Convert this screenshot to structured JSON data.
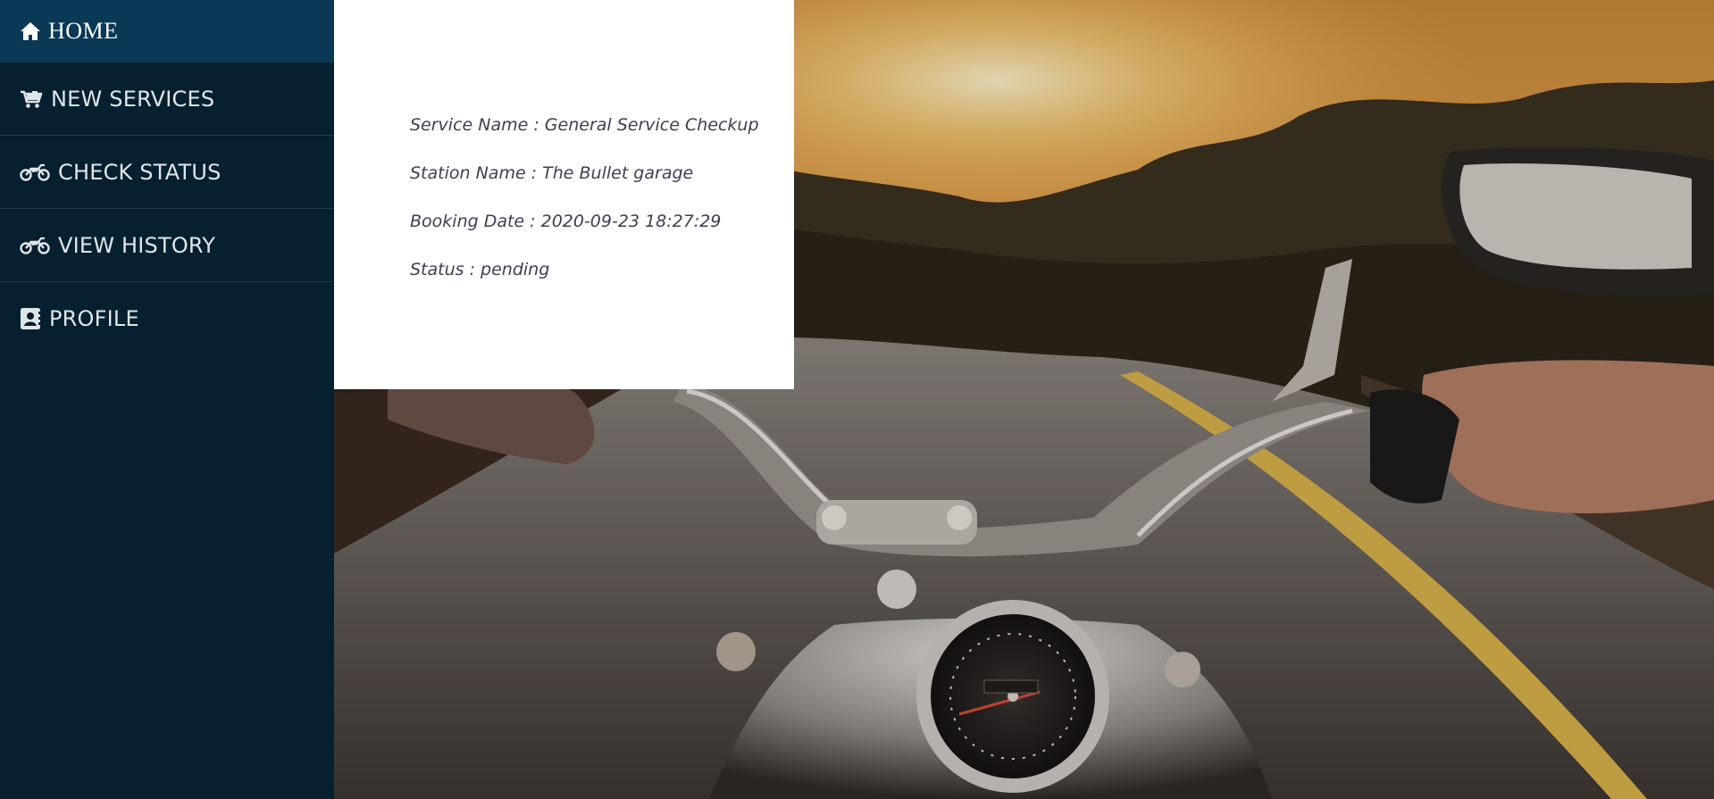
{
  "sidebar": {
    "home": {
      "label": "HOME",
      "icon": "home-icon"
    },
    "items": [
      {
        "label": "NEW SERVICES",
        "icon": "cart-icon"
      },
      {
        "label": "CHECK STATUS",
        "icon": "motorcycle-icon"
      },
      {
        "label": "VIEW HISTORY",
        "icon": "motorcycle-icon"
      },
      {
        "label": "PROFILE",
        "icon": "address-book-icon"
      }
    ]
  },
  "booking": {
    "service_name": "Service Name : General Service Checkup",
    "station_name": "Station Name : The Bullet garage",
    "booking_date": "Booking Date : 2020-09-23 18:27:29",
    "status": "Status : pending"
  },
  "background": {
    "image": "motorcycle-road-photo",
    "sky_color": "#e5a14a",
    "road_color": "#5b534d"
  }
}
